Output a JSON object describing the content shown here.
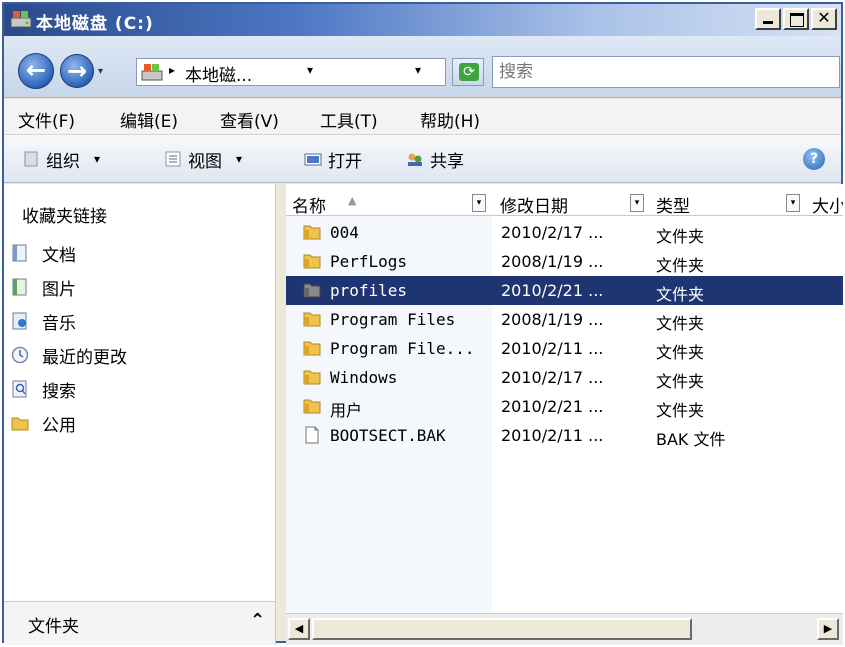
{
  "window": {
    "title": "本地磁盘 (C:)"
  },
  "colors": {
    "selection": "#1e3572",
    "titlebar_start": "#2a4a8c",
    "folder": "#e9b83a"
  },
  "address": {
    "text": "本地磁...",
    "crumb_arrow": "▸",
    "dropdown_glyph": "▾"
  },
  "search": {
    "placeholder": "搜索"
  },
  "menu": [
    "文件(F)",
    "编辑(E)",
    "查看(V)",
    "工具(T)",
    "帮助(H)"
  ],
  "toolbar": {
    "organize": "组织",
    "views": "视图",
    "open": "打开",
    "share": "共享",
    "dropdown_glyph": "▾",
    "help_glyph": "?"
  },
  "nav": {
    "heading": "收藏夹链接",
    "items": [
      {
        "label": "文档",
        "icon": "documents-icon"
      },
      {
        "label": "图片",
        "icon": "pictures-icon"
      },
      {
        "label": "音乐",
        "icon": "music-icon"
      },
      {
        "label": "最近的更改",
        "icon": "recent-changes-icon"
      },
      {
        "label": "搜索",
        "icon": "searches-icon"
      },
      {
        "label": "公用",
        "icon": "public-folder-icon"
      }
    ],
    "folders_label": "文件夹",
    "folders_chevron": "⌃"
  },
  "columns": {
    "name": "名称",
    "modified": "修改日期",
    "type": "类型",
    "size": "大小",
    "sort_glyph": "▲",
    "drop_glyph": "▾"
  },
  "files": [
    {
      "name": "004",
      "modified": "2010/2/17 ...",
      "type": "文件夹",
      "kind": "folder",
      "selected": false
    },
    {
      "name": "PerfLogs",
      "modified": "2008/1/19 ...",
      "type": "文件夹",
      "kind": "folder",
      "selected": false
    },
    {
      "name": "profiles",
      "modified": "2010/2/21 ...",
      "type": "文件夹",
      "kind": "folder-dark",
      "selected": true
    },
    {
      "name": "Program Files",
      "modified": "2008/1/19 ...",
      "type": "文件夹",
      "kind": "folder",
      "selected": false
    },
    {
      "name": "Program File...",
      "modified": "2010/2/11 ...",
      "type": "文件夹",
      "kind": "folder",
      "selected": false
    },
    {
      "name": "Windows",
      "modified": "2010/2/17 ...",
      "type": "文件夹",
      "kind": "folder",
      "selected": false
    },
    {
      "name": "用户",
      "modified": "2010/2/21 ...",
      "type": "文件夹",
      "kind": "folder",
      "selected": false
    },
    {
      "name": "BOOTSECT.BAK",
      "modified": "2010/2/11 ...",
      "type": "BAK 文件",
      "kind": "file",
      "selected": false
    }
  ],
  "scrollbar": {
    "left_glyph": "◀",
    "right_glyph": "▶"
  }
}
